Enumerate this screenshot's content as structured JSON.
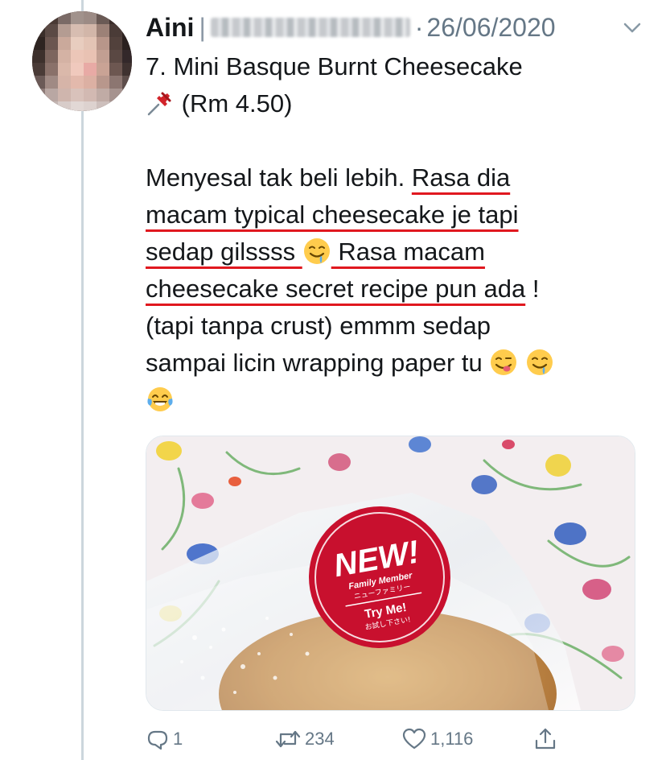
{
  "tweet": {
    "author_name": "Aini",
    "author_separator": "|",
    "dot": "·",
    "date": "26/06/2020",
    "lines": {
      "l1": "7. Mini Basque Burnt Cheesecake",
      "l2_emoji_icon": "pushpin-icon",
      "l2": "(Rm 4.50)",
      "l3a": "Menyesal tak beli lebih. ",
      "l3b": "Rasa dia",
      "l4": "macam typical cheesecake je tapi",
      "l5a": "sedap gilssss ",
      "l5_emoji_icon": "drooling-face-icon",
      "l5b": " Rasa macam",
      "l6a": "cheesecake secret recipe pun ada",
      "l6b": " !",
      "l7": "(tapi tanpa crust) emmm sedap",
      "l8": "sampai licin wrapping paper tu ",
      "l8_emoji_icons": [
        "yum-face-icon",
        "drooling-face-icon"
      ],
      "l9_emoji_icon": "tears-of-joy-icon"
    },
    "underline_color": "#e0181f"
  },
  "media": {
    "sticker": {
      "headline": "NEW!",
      "line1": "Family Member",
      "line2": "ニューファミリー",
      "line3": "Try Me!",
      "line4": "お試し下さい!"
    },
    "sticker_color": "#c8102e"
  },
  "actions": {
    "reply_count": "1",
    "retweet_count": "234",
    "like_count": "1,116",
    "icons": [
      "reply-icon",
      "retweet-icon",
      "like-icon",
      "share-icon"
    ]
  },
  "colors": {
    "text": "#14171a",
    "muted": "#657786",
    "thread_line": "#ccd6dd"
  }
}
